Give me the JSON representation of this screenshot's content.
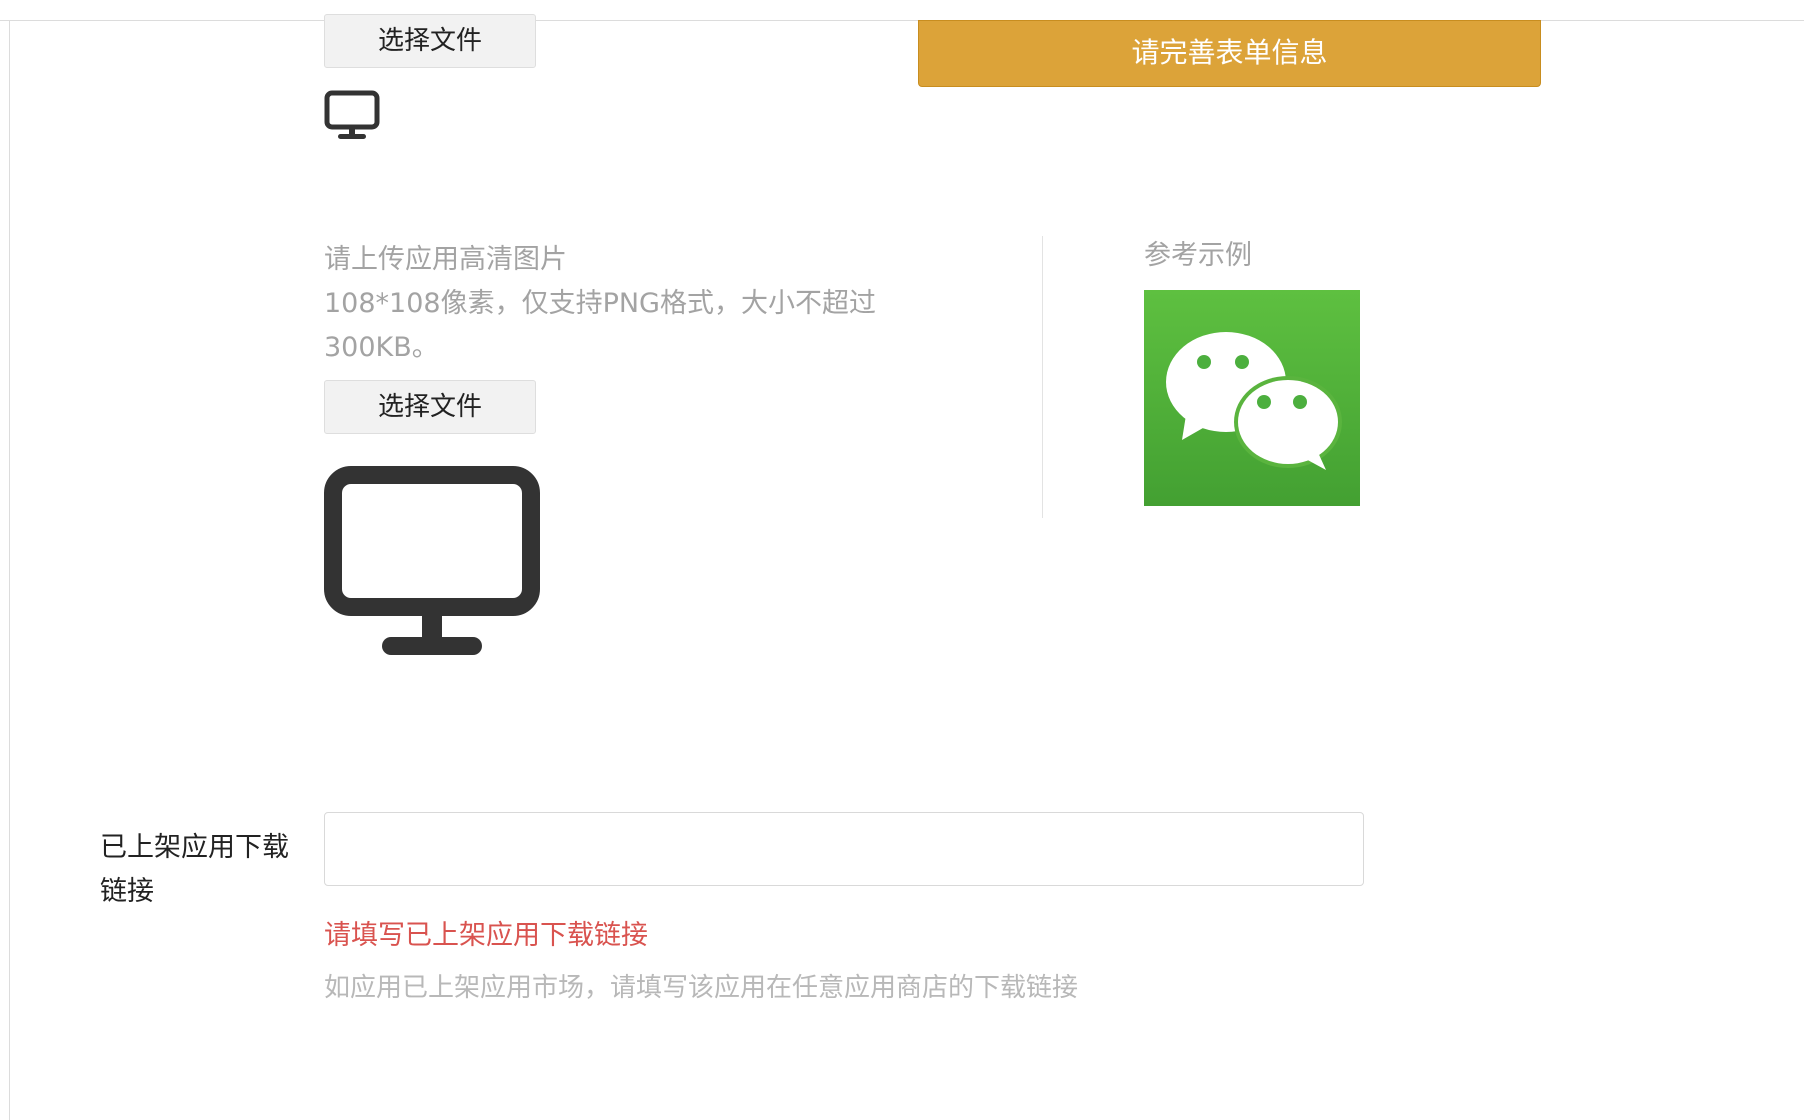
{
  "upload_top": {
    "button_label": "选择文件"
  },
  "tip_banner": {
    "label": "请完善表单信息",
    "color": "#dca339"
  },
  "upload_hd": {
    "title": "请上传应用高清图片",
    "desc_line1": "108*108像素，仅支持PNG格式，大小不超过",
    "desc_line2": "300KB。",
    "button_label": "选择文件"
  },
  "example": {
    "label": "参考示例",
    "brand_color": "#4caf3e"
  },
  "download_link": {
    "label_line1": "已上架应用下载",
    "label_line2": "链接",
    "value": "",
    "placeholder": "",
    "error": "请填写已上架应用下载链接",
    "error_color": "#d9534f",
    "help": "如应用已上架应用市场，请填写该应用在任意应用商店的下载链接"
  },
  "icons": {
    "placeholder_small": "monitor-icon",
    "placeholder_large": "monitor-icon",
    "example": "wechat-logo-icon"
  }
}
